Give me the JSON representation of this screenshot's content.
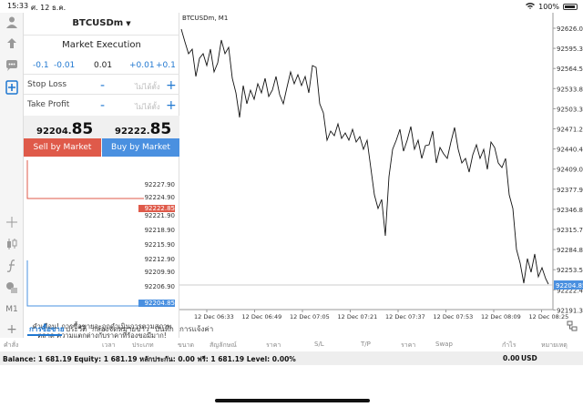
{
  "status_bar": {
    "time": "15:33",
    "date": "ศ. 12 ธ.ค.",
    "battery": "100%"
  },
  "order_panel": {
    "symbol": "BTCUSDm",
    "execution": "Market Execution",
    "volume": {
      "minus_large": "-0.1",
      "minus_small": "-0.01",
      "value": "0.01",
      "plus_small": "+0.01",
      "plus_large": "+0.1"
    },
    "stop_loss": {
      "label": "Stop Loss",
      "minus": "-",
      "placeholder": "ไม่ได้ตั้ง",
      "plus": "+"
    },
    "take_profit": {
      "label": "Take Profit",
      "minus": "-",
      "placeholder": "ไม่ได้ตั้ง",
      "plus": "+"
    },
    "bid": {
      "main": "92204.",
      "big": "85"
    },
    "ask": {
      "main": "92222.",
      "big": "85"
    },
    "sell_label": "Sell by Market",
    "buy_label": "Buy by Market",
    "mini_scale": [
      "92227.90",
      "92224.90",
      "92222.85",
      "92221.90",
      "92218.90",
      "92215.90",
      "92212.90",
      "92209.90",
      "92206.90",
      "92204.85"
    ],
    "warning": "คำเตือน! การซื้อขายจะถูกดำเนินการตามสภาพตลาด ความแตกต่างกับราคาที่ร้องขอมีมาก!"
  },
  "chart": {
    "label": "BTCUSDm, M1",
    "current_price": "92204.85",
    "y_ticks": [
      "92626.00",
      "92595.30",
      "92564.50",
      "92533.80",
      "92503.30",
      "92471.20",
      "92440.40",
      "92409.00",
      "92377.90",
      "92346.80",
      "92315.70",
      "92284.80",
      "92253.50",
      "92222.40",
      "92191.30"
    ],
    "x_ticks": [
      "12 Dec 06:33",
      "12 Dec 06:49",
      "12 Dec 07:05",
      "12 Dec 07:21",
      "12 Dec 07:37",
      "12 Dec 07:53",
      "12 Dec 08:09",
      "12 Dec 08:25"
    ]
  },
  "tabs": [
    "การซื้อขาย",
    "ประวัติ",
    "กล่องจดหมาย",
    "ข่าว",
    "บันทึก",
    "การแจ้งค่า"
  ],
  "columns": [
    "คำสั่ง",
    "เวลา",
    "ประเภท",
    "ขนาด",
    "สัญลักษณ์",
    "ราคา",
    "S/L",
    "T/P",
    "ราคา",
    "Swap",
    "กำไร",
    "หมายเหตุ"
  ],
  "balance": {
    "text": "Balance: 1 681.19  Equity: 1 681.19  หลักประกัน: 0.00  ฟรี: 1 681.19  Level: 0.00%",
    "profit": "0.00",
    "currency": "USD"
  },
  "accent": "#1f77d0",
  "sell_color": "#df5a4a",
  "buy_color": "#4a90e0"
}
